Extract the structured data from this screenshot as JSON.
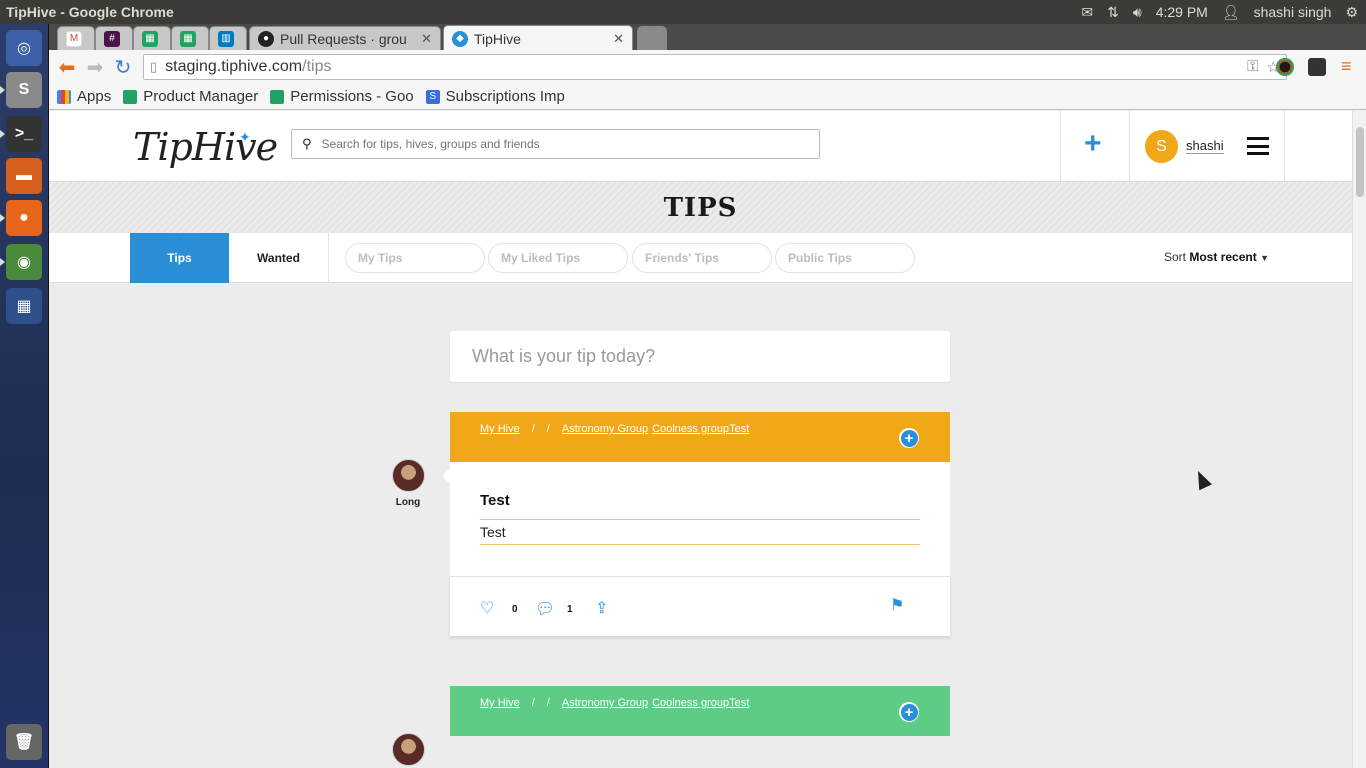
{
  "os": {
    "window_title": "TipHive - Google Chrome",
    "time": "4:29 PM",
    "user": "shashi singh"
  },
  "browser": {
    "tabs": [
      {
        "label": "",
        "type": "gmail"
      },
      {
        "label": "",
        "type": "slack"
      },
      {
        "label": "",
        "type": "sheets"
      },
      {
        "label": "",
        "type": "sheets"
      },
      {
        "label": "",
        "type": "trello"
      },
      {
        "label": "Pull Requests · grou",
        "type": "github"
      },
      {
        "label": "TipHive",
        "type": "tiphive",
        "active": true
      }
    ],
    "url_host": "staging.tiphive.com",
    "url_path": "/tips",
    "bookmarks": [
      {
        "label": "Apps"
      },
      {
        "label": "Product Manager"
      },
      {
        "label": "Permissions - Goo"
      },
      {
        "label": "Subscriptions Imp"
      }
    ]
  },
  "site": {
    "logo_text": "TipHive",
    "search_placeholder": "Search for tips, hives, groups and friends",
    "username": "shashi",
    "avatar_letter": "S",
    "banner_title": "TIPS",
    "tabs": {
      "tips": "Tips",
      "wanted": "Wanted"
    },
    "filters": [
      "My Tips",
      "My Liked Tips",
      "Friends' Tips",
      "Public Tips"
    ],
    "sort_label": "Sort",
    "sort_value": "Most recent",
    "tip_prompt": "What is your tip today?",
    "cards": [
      {
        "color": "#f0a818",
        "crumbs": {
          "hive": "My Hive",
          "sep1": "/",
          "sep2": "/",
          "group1": "Astronomy Group",
          "group2": "Coolness groupTest"
        },
        "author": "Long",
        "title": "Test",
        "body": "Test",
        "likes": "0",
        "comments": "1"
      },
      {
        "color": "#5ecc84",
        "crumbs": {
          "hive": "My Hive",
          "sep1": "/",
          "sep2": "/",
          "group1": "Astronomy Group",
          "group2": "Coolness groupTest"
        }
      }
    ]
  },
  "colors": {
    "accent": "#2a8fd6",
    "card1": "#f0a818",
    "card2": "#5ecc84"
  }
}
